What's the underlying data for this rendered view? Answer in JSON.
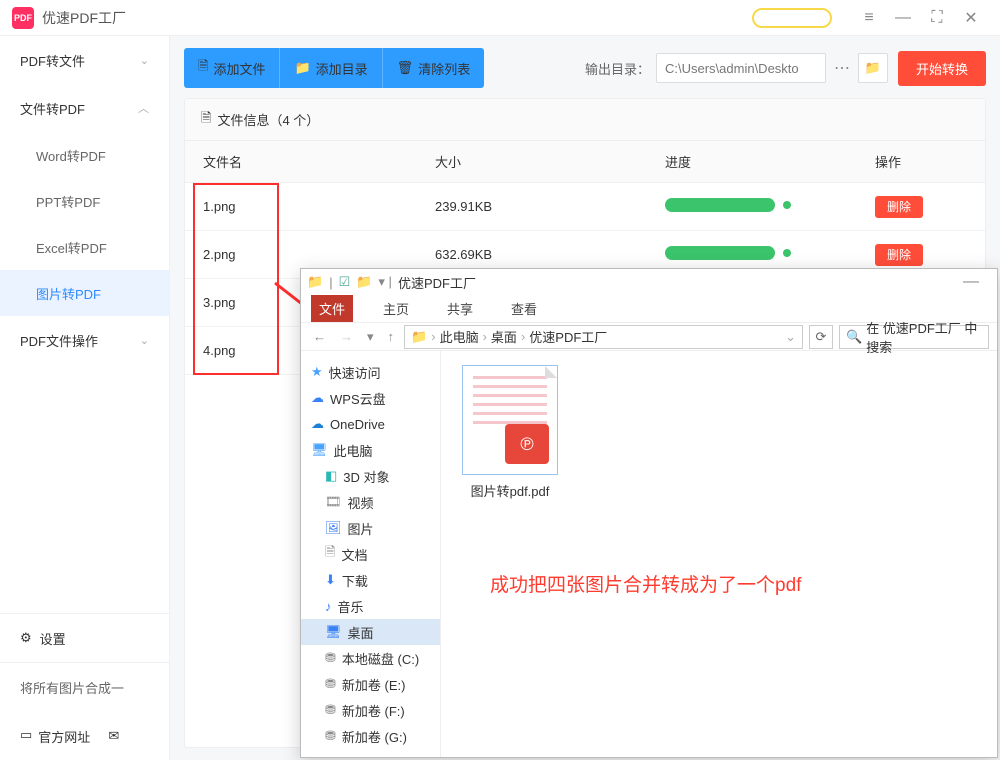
{
  "titlebar": {
    "app": "优速PDF工厂"
  },
  "sidebar": {
    "items": [
      {
        "label": "PDF转文件",
        "chev": "⌄"
      },
      {
        "label": "文件转PDF",
        "chev": "︿"
      },
      {
        "label": "PDF文件操作",
        "chev": "⌄"
      }
    ],
    "subs": [
      "Word转PDF",
      "PPT转PDF",
      "Excel转PDF",
      "图片转PDF"
    ],
    "settings": "设置",
    "merge": "将所有图片合成一",
    "site": "官方网址"
  },
  "toolbar": {
    "add_file": "添加文件",
    "add_dir": "添加目录",
    "clear": "清除列表",
    "out_label": "输出目录：",
    "out_path": "C:\\Users\\admin\\Deskto",
    "start": "开始转换"
  },
  "panel": {
    "head": "文件信息（4 个）"
  },
  "columns": {
    "name": "文件名",
    "size": "大小",
    "prog": "进度",
    "act": "操作"
  },
  "rows": [
    {
      "name": "1.png",
      "size": "239.91KB",
      "del": "删除"
    },
    {
      "name": "2.png",
      "size": "632.69KB",
      "del": "删除"
    },
    {
      "name": "3.png",
      "size": "",
      "del": ""
    },
    {
      "name": "4.png",
      "size": "",
      "del": ""
    }
  ],
  "explorer": {
    "title": "优速PDF工厂",
    "tabs": [
      "文件",
      "主页",
      "共享",
      "查看"
    ],
    "crumbs": [
      "此电脑",
      "桌面",
      "优速PDF工厂"
    ],
    "search_ph": "在 优速PDF工厂 中搜索",
    "tree": [
      "快速访问",
      "WPS云盘",
      "OneDrive",
      "此电脑",
      "3D 对象",
      "视频",
      "图片",
      "文档",
      "下载",
      "音乐",
      "桌面",
      "本地磁盘 (C:)",
      "新加卷 (E:)",
      "新加卷 (F:)",
      "新加卷 (G:)"
    ],
    "file_name": "图片转pdf.pdf"
  },
  "annotation": "成功把四张图片合并转成为了一个pdf"
}
